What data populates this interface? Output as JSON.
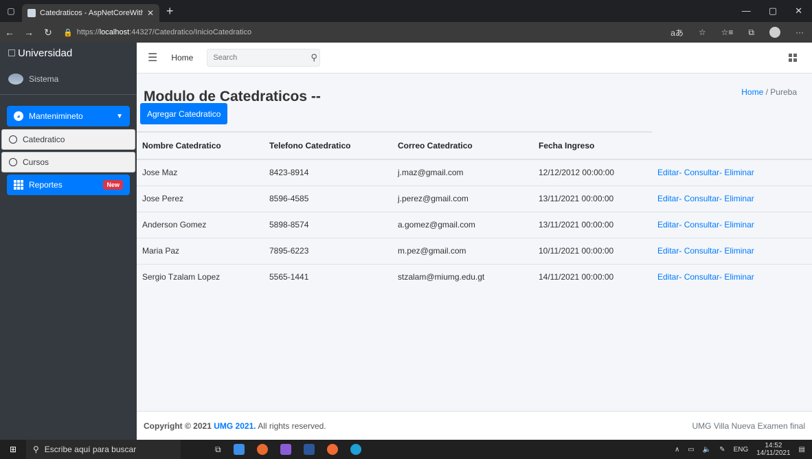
{
  "browser": {
    "tab_title": "Catedraticos - AspNetCoreWith/",
    "url_prefix": "https://",
    "url_host": "localhost",
    "url_rest": ":44327/Catedratico/InicioCatedratico"
  },
  "sidebar": {
    "brand": "Universidad",
    "user": "Sistema",
    "menu": {
      "mantenimiento": "Mantenimineto",
      "catedratico": "Catedratico",
      "cursos": "Cursos",
      "reportes": "Reportes",
      "reportes_badge": "New"
    }
  },
  "topnav": {
    "home": "Home",
    "search_placeholder": "Search"
  },
  "page": {
    "title": "Modulo de Catedraticos --",
    "breadcrumb_home": "Home",
    "breadcrumb_sep": "/",
    "breadcrumb_current": "Pureba",
    "add_button": "Agregar Catedratico"
  },
  "table": {
    "headers": [
      "Nombre Catedratico",
      "Telefono Catedratico",
      "Correo Catedratico",
      "Fecha Ingreso"
    ],
    "rows": [
      {
        "nombre": "Jose Maz",
        "telefono": "8423-8914",
        "correo": "j.maz@gmail.com",
        "fecha": "12/12/2012 00:00:00"
      },
      {
        "nombre": "Jose Perez",
        "telefono": "8596-4585",
        "correo": "j.perez@gmail.com",
        "fecha": "13/11/2021 00:00:00"
      },
      {
        "nombre": "Anderson Gomez",
        "telefono": "5898-8574",
        "correo": "a.gomez@gmail.com",
        "fecha": "13/11/2021 00:00:00"
      },
      {
        "nombre": "Maria Paz",
        "telefono": "7895-6223",
        "correo": "m.pez@gmail.com",
        "fecha": "10/11/2021 00:00:00"
      },
      {
        "nombre": "Sergio Tzalam Lopez",
        "telefono": "5565-1441",
        "correo": "stzalam@miumg.edu.gt",
        "fecha": "14/11/2021 00:00:00"
      }
    ],
    "action_editar": "Editar-",
    "action_consultar": "Consultar-",
    "action_eliminar": "Eliminar"
  },
  "footer": {
    "copyright": "Copyright © 2021",
    "brand": "UMG 2021.",
    "rights": "All rights reserved.",
    "right_text": "UMG Villa Nueva Examen final"
  },
  "taskbar": {
    "search_placeholder": "Escribe aquí para buscar",
    "lang": "ENG",
    "time": "14:52",
    "date": "14/11/2021"
  },
  "colors": {
    "accent": "#007bff",
    "sidebar_bg": "#343a40",
    "badge": "#dc3545"
  }
}
